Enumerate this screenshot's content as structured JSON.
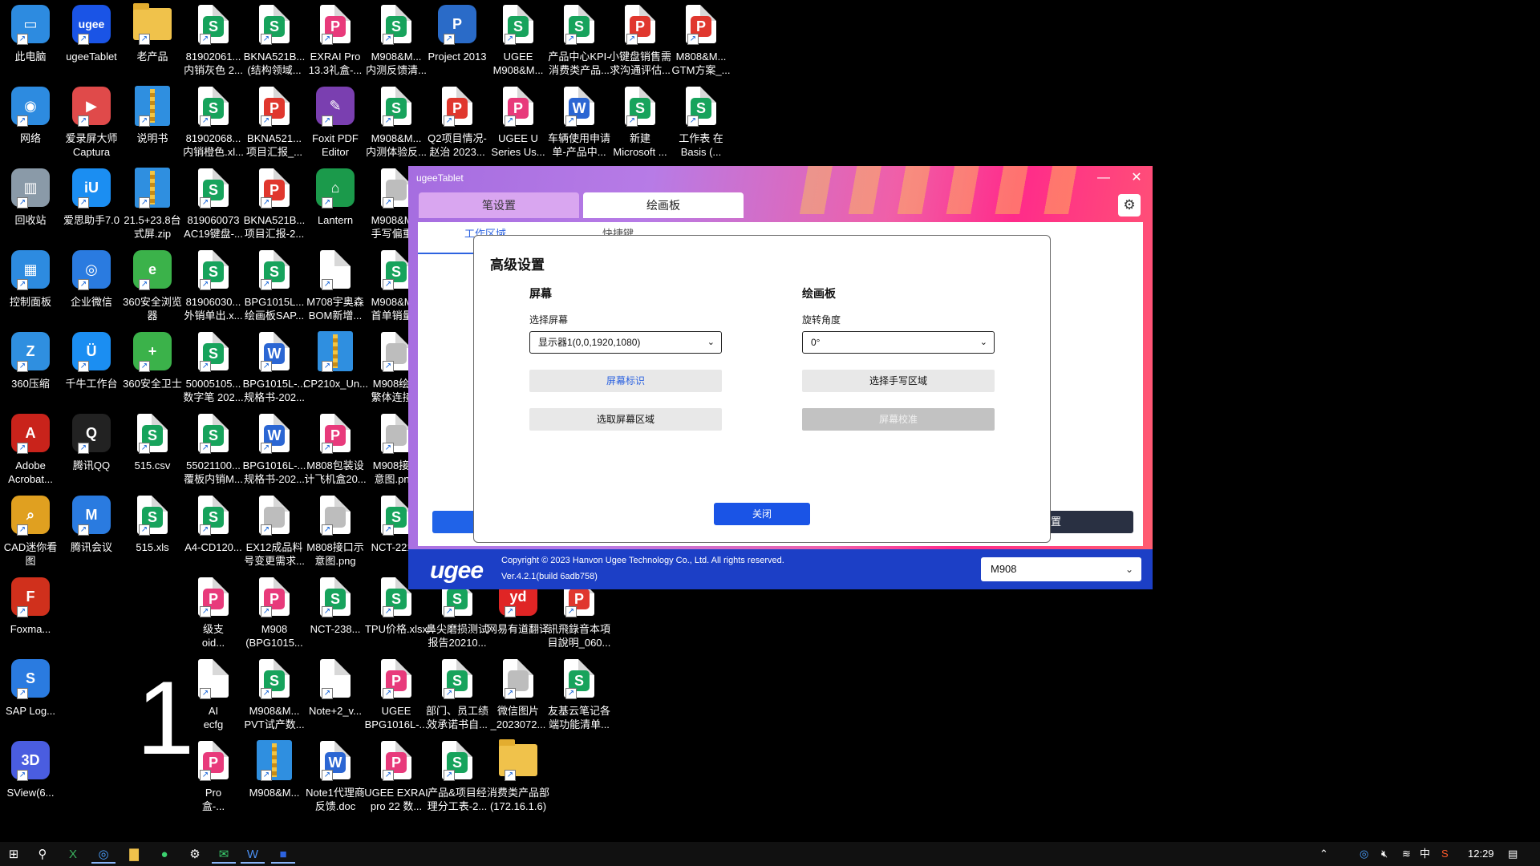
{
  "desktop": {
    "icons": [
      {
        "label": "此电脑",
        "icon": "this-pc-icon"
      },
      {
        "label": "ugeeTablet",
        "icon": "ugee-app-icon"
      },
      {
        "label": "老产品",
        "icon": "folder-icon"
      },
      {
        "label": "81902061...\n内销灰色 2...",
        "icon": "spreadsheet-icon"
      },
      {
        "label": "BKNA521B...\n(结构领域...",
        "icon": "spreadsheet-icon"
      },
      {
        "label": "EXRAI Pro\n13.3礼盒-...",
        "icon": "pdf-icon"
      },
      {
        "label": "M908&M...\n内测反馈清...",
        "icon": "spreadsheet-icon"
      },
      {
        "label": "Project 2013",
        "icon": "project-icon"
      },
      {
        "label": "UGEE\nM908&M...",
        "icon": "spreadsheet-icon"
      },
      {
        "label": "产品中心KPI-\n消费类产品...",
        "icon": "spreadsheet-icon"
      },
      {
        "label": "小键盘销售需\n求沟通评估...",
        "icon": "presentation-icon"
      },
      {
        "label": "M808&M...\nGTM方案_...",
        "icon": "presentation-icon"
      },
      {
        "label": "网络",
        "icon": "network-icon"
      },
      {
        "label": "爱录屏大师\nCaptura",
        "icon": "screen-recorder-icon"
      },
      {
        "label": "说明书",
        "icon": "zip-icon"
      },
      {
        "label": "81902068...\n内销橙色.xl...",
        "icon": "spreadsheet-icon"
      },
      {
        "label": "BKNA521...\n项目汇报_...",
        "icon": "presentation-icon"
      },
      {
        "label": "Foxit PDF\nEditor",
        "icon": "foxit-icon"
      },
      {
        "label": "M908&M...\n内测体验反...",
        "icon": "spreadsheet-icon"
      },
      {
        "label": "Q2项目情况-\n赵治 2023...",
        "icon": "presentation-icon"
      },
      {
        "label": "UGEE U\nSeries Us...",
        "icon": "pdf-icon"
      },
      {
        "label": "车辆使用申请\n单-产品中...",
        "icon": "word-icon"
      },
      {
        "label": "新建\nMicrosoft ...",
        "icon": "spreadsheet-icon"
      },
      {
        "label": "工作表 在\nBasis (...",
        "icon": "spreadsheet-icon"
      },
      {
        "label": "回收站",
        "icon": "recycle-bin-icon"
      },
      {
        "label": "爱思助手7.0",
        "icon": "i4-icon"
      },
      {
        "label": "21.5+23.8台\n式屏.zip",
        "icon": "zip-icon"
      },
      {
        "label": "819060073\nAC19键盘-...",
        "icon": "spreadsheet-icon"
      },
      {
        "label": "BKNA521B...\n项目汇报-2...",
        "icon": "presentation-icon"
      },
      {
        "label": "Lantern",
        "icon": "lantern-icon"
      },
      {
        "label": "M908&M...\n手写偏重...",
        "icon": "image-icon"
      },
      {
        "label": "控制面板",
        "icon": "control-panel-icon"
      },
      {
        "label": "企业微信",
        "icon": "wecom-icon"
      },
      {
        "label": "360安全浏览\n器",
        "icon": "360-browser-icon"
      },
      {
        "label": "81906030...\n外销单出.x...",
        "icon": "spreadsheet-icon"
      },
      {
        "label": "BPG1015L...\n绘画板SAP...",
        "icon": "spreadsheet-icon"
      },
      {
        "label": "M708宇奥森\nBOM新增...",
        "icon": "document-icon"
      },
      {
        "label": "M908&M...\n首单销量...",
        "icon": "spreadsheet-icon"
      },
      {
        "label": "360压缩",
        "icon": "360-zip-icon"
      },
      {
        "label": "千牛工作台",
        "icon": "qianniu-icon"
      },
      {
        "label": "360安全卫士",
        "icon": "360-security-icon"
      },
      {
        "label": "50005105...\n数字笔 202...",
        "icon": "spreadsheet-icon"
      },
      {
        "label": "BPG1015L-...\n规格书-202...",
        "icon": "word-icon"
      },
      {
        "label": "CP210x_Un...",
        "icon": "zip-icon"
      },
      {
        "label": "M908绘画\n繁体连接...",
        "icon": "image-icon"
      },
      {
        "label": "Adobe\nAcrobat...",
        "icon": "acrobat-icon"
      },
      {
        "label": "腾讯QQ",
        "icon": "qq-icon"
      },
      {
        "label": "515.csv",
        "icon": "spreadsheet-icon"
      },
      {
        "label": "55021100...\n覆板内销M...",
        "icon": "spreadsheet-icon"
      },
      {
        "label": "BPG1016L-...\n规格书-202...",
        "icon": "word-icon"
      },
      {
        "label": "M808包装设\n计飞机盒20...",
        "icon": "pdf-icon"
      },
      {
        "label": "M908接口\n意图.pn...",
        "icon": "image-icon"
      },
      {
        "label": "CAD迷你看\n图",
        "icon": "cad-icon"
      },
      {
        "label": "腾讯会议",
        "icon": "tencent-meeting-icon"
      },
      {
        "label": "515.xls",
        "icon": "spreadsheet-icon"
      },
      {
        "label": "A4-CD120...",
        "icon": "spreadsheet-icon"
      },
      {
        "label": "EX12成品料\n号变更需求...",
        "icon": "image-icon"
      },
      {
        "label": "M808接口示\n意图.png",
        "icon": "image-icon"
      },
      {
        "label": "NCT-221...",
        "icon": "spreadsheet-icon"
      },
      {
        "label": "Foxma...",
        "icon": "foxmail-icon"
      },
      {
        "label": "级支\noid...",
        "icon": "pdf-icon"
      },
      {
        "label": "M908\n(BPG1015...",
        "icon": "pdf-icon"
      },
      {
        "label": "NCT-238...",
        "icon": "spreadsheet-icon"
      },
      {
        "label": "TPU价格.xlsx",
        "icon": "spreadsheet-icon"
      },
      {
        "label": "鼻尖磨损测试\n报告20210...",
        "icon": "spreadsheet-icon"
      },
      {
        "label": "网易有道翻译",
        "icon": "youdao-icon"
      },
      {
        "label": "訊飛錄音本項\n目說明_060...",
        "icon": "presentation-icon"
      },
      {
        "label": "SAP Log...",
        "icon": "sap-icon"
      },
      {
        "label": "AI\necfg",
        "icon": "document-icon"
      },
      {
        "label": "M908&M...\nPVT试产数...",
        "icon": "spreadsheet-icon"
      },
      {
        "label": "Note+2_v...",
        "icon": "document-icon"
      },
      {
        "label": "UGEE\nBPG1016L-...",
        "icon": "pdf-icon"
      },
      {
        "label": "部门、员工绩\n效承诺书自...",
        "icon": "spreadsheet-icon"
      },
      {
        "label": "微信图片\n_2023072...",
        "icon": "image-icon"
      },
      {
        "label": "友基云笔记各\n端功能清单...",
        "icon": "spreadsheet-icon"
      },
      {
        "label": "SView(6...",
        "icon": "sview-icon"
      },
      {
        "label": "Pro\n盒-...",
        "icon": "pdf-icon"
      },
      {
        "label": "M908&M...",
        "icon": "zip-icon"
      },
      {
        "label": "Note1代理商\n反馈.doc",
        "icon": "word-icon"
      },
      {
        "label": "UGEE EXRAI\npro 22 数...",
        "icon": "pdf-icon"
      },
      {
        "label": "产品&项目经\n理分工表-2...",
        "icon": "spreadsheet-icon"
      },
      {
        "label": "消费类产品部\n(172.16.1.6)",
        "icon": "network-folder-icon"
      }
    ],
    "big_digit": "1"
  },
  "window": {
    "title": "ugeeTablet",
    "tabs": [
      "笔设置",
      "绘画板"
    ],
    "subtabs": [
      "工作区域",
      "快捷键"
    ],
    "bottom_right_button": "高级设置",
    "copyright": "Copyright © 2023 Hanvon Ugee Technology Co., Ltd. All rights reserved.",
    "version": "Ver.4.2.1(build 6adb758)",
    "logo_text": "ugee",
    "device_model": "M908"
  },
  "dialog": {
    "title": "高级设置",
    "screen": {
      "heading": "屏幕",
      "select_label": "选择屏幕",
      "select_value": "显示器1(0,0,1920,1080)",
      "identify_button": "屏幕标识",
      "region_button": "选取屏幕区域"
    },
    "board": {
      "heading": "绘画板",
      "rotate_label": "旋转角度",
      "rotate_value": "0°",
      "handwriting_button": "选择手写区域",
      "calibrate_button": "屏幕校准"
    },
    "close_button": "关闭"
  },
  "taskbar": {
    "time": "12:29",
    "ime": "中",
    "accent": "#1a54e6"
  }
}
